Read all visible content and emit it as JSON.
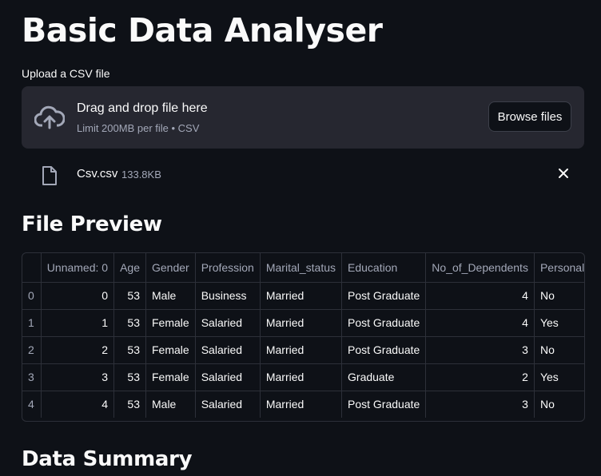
{
  "page_title": "Basic Data Analyser",
  "uploader": {
    "label": "Upload a CSV file",
    "drop_title": "Drag and drop file here",
    "drop_sub": "Limit 200MB per file • CSV",
    "browse_label": "Browse files"
  },
  "file": {
    "name": "Csv.csv",
    "size": "133.8KB"
  },
  "preview": {
    "heading": "File Preview",
    "columns": [
      "",
      "Unnamed: 0",
      "Age",
      "Gender",
      "Profession",
      "Marital_status",
      "Education",
      "No_of_Dependents",
      "Personal_loan"
    ],
    "rows": [
      [
        "0",
        "0",
        "53",
        "Male",
        "Business",
        "Married",
        "Post Graduate",
        "4",
        "No"
      ],
      [
        "1",
        "1",
        "53",
        "Female",
        "Salaried",
        "Married",
        "Post Graduate",
        "4",
        "Yes"
      ],
      [
        "2",
        "2",
        "53",
        "Female",
        "Salaried",
        "Married",
        "Post Graduate",
        "3",
        "No"
      ],
      [
        "3",
        "3",
        "53",
        "Female",
        "Salaried",
        "Married",
        "Graduate",
        "2",
        "Yes"
      ],
      [
        "4",
        "4",
        "53",
        "Male",
        "Salaried",
        "Married",
        "Post Graduate",
        "3",
        "No"
      ]
    ]
  },
  "summary": {
    "heading": "Data Summary"
  },
  "icons": {
    "upload": "cloud-upload-icon",
    "file": "file-icon",
    "close": "close-icon"
  },
  "colors": {
    "background": "#0e1117",
    "panel": "#262730",
    "muted": "#a3a8b8"
  }
}
